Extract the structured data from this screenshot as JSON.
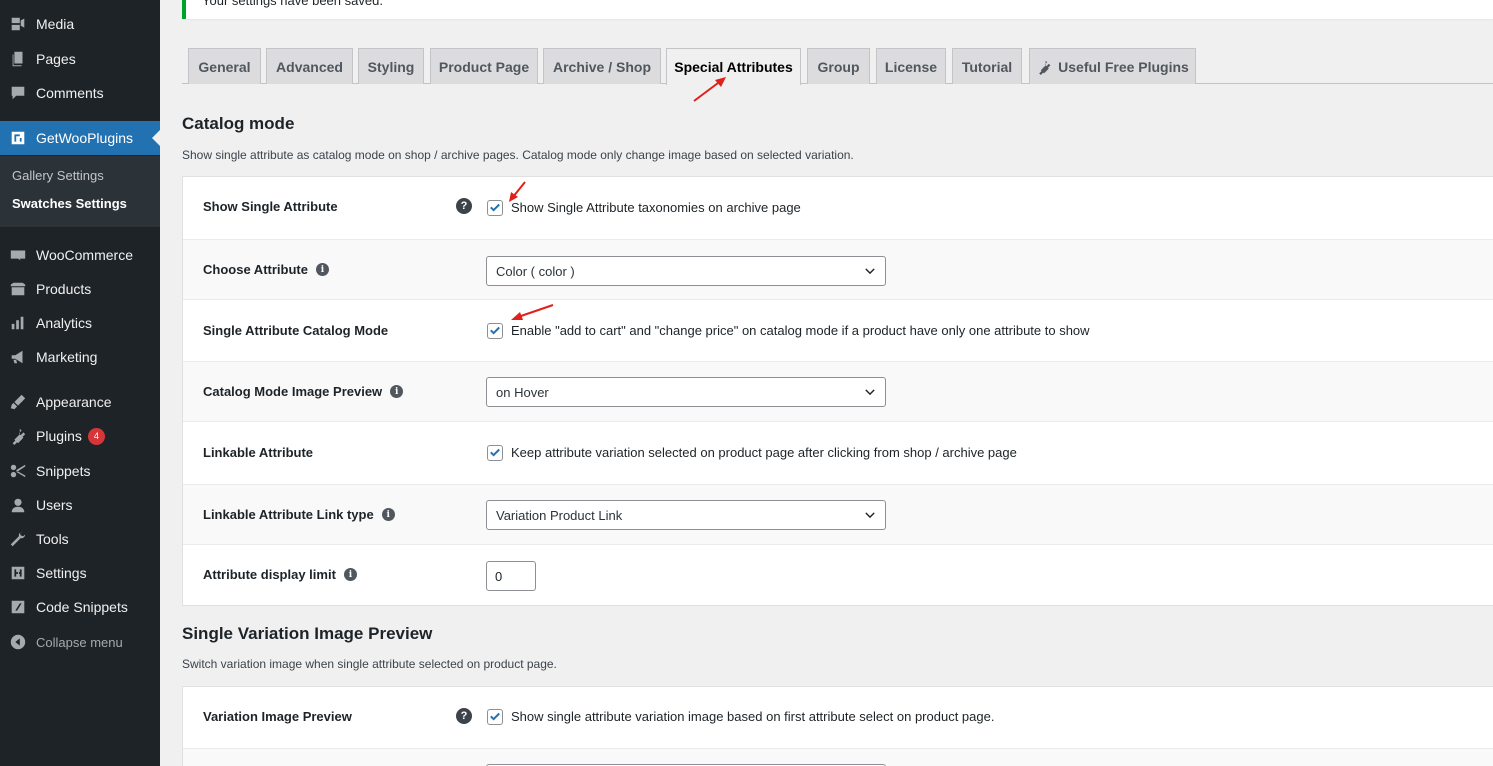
{
  "sidebar": {
    "items": [
      {
        "label": "Media",
        "icon": "media-icon"
      },
      {
        "label": "Pages",
        "icon": "pages-icon"
      },
      {
        "label": "Comments",
        "icon": "comments-icon"
      },
      {
        "label": "GetWooPlugins",
        "icon": "plugin-brand-icon"
      },
      {
        "label": "WooCommerce",
        "icon": "woocommerce-icon"
      },
      {
        "label": "Products",
        "icon": "products-icon"
      },
      {
        "label": "Analytics",
        "icon": "analytics-icon"
      },
      {
        "label": "Marketing",
        "icon": "marketing-icon"
      },
      {
        "label": "Appearance",
        "icon": "appearance-icon"
      },
      {
        "label": "Plugins",
        "icon": "plugins-icon",
        "badge": "4"
      },
      {
        "label": "Snippets",
        "icon": "snippets-icon"
      },
      {
        "label": "Users",
        "icon": "users-icon"
      },
      {
        "label": "Tools",
        "icon": "tools-icon"
      },
      {
        "label": "Settings",
        "icon": "settings-icon"
      },
      {
        "label": "Code Snippets",
        "icon": "code-snippets-icon"
      }
    ],
    "submenu": [
      "Gallery Settings",
      "Swatches Settings"
    ],
    "collapse": "Collapse menu"
  },
  "notice": {
    "text": "Your settings have been saved."
  },
  "tabs": [
    "General",
    "Advanced",
    "Styling",
    "Product Page",
    "Archive / Shop",
    "Special Attributes",
    "Group",
    "License",
    "Tutorial",
    "Useful Free Plugins"
  ],
  "catalog": {
    "title": "Catalog mode",
    "description": "Show single attribute as catalog mode on shop / archive pages. Catalog mode only change image based on selected variation.",
    "rows": {
      "show_single": {
        "label": "Show Single Attribute",
        "text": "Show Single Attribute taxonomies on archive page"
      },
      "choose_attr": {
        "label": "Choose Attribute",
        "value": "Color ( color )"
      },
      "catalog_mode": {
        "label": "Single Attribute Catalog Mode",
        "text": "Enable \"add to cart\" and \"change price\" on catalog mode if a product have only one attribute to show"
      },
      "image_preview": {
        "label": "Catalog Mode Image Preview",
        "value": "on Hover"
      },
      "linkable": {
        "label": "Linkable Attribute",
        "text": "Keep attribute variation selected on product page after clicking from shop / archive page"
      },
      "link_type": {
        "label": "Linkable Attribute Link type",
        "value": "Variation Product Link"
      },
      "display_limit": {
        "label": "Attribute display limit",
        "value": "0"
      }
    }
  },
  "variation": {
    "title": "Single Variation Image Preview",
    "description": "Switch variation image when single attribute selected on product page.",
    "rows": {
      "preview": {
        "label": "Variation Image Preview",
        "text": "Show single attribute variation image based on first attribute select on product page."
      }
    }
  },
  "colors": {
    "accent": "#2271b1",
    "sidebar": "#1d2327",
    "annotation": "#e0201a"
  }
}
